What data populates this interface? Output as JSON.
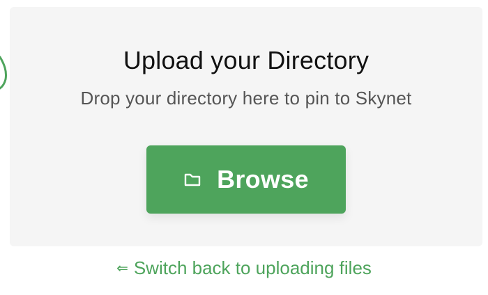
{
  "upload": {
    "title": "Upload your Directory",
    "subtitle": "Drop your directory here to pin to Skynet",
    "browse_button": {
      "label": "Browse",
      "icon": "folder-icon"
    },
    "switch_link": {
      "arrow": "⇐",
      "label": "Switch back to uploading files"
    }
  },
  "colors": {
    "accent": "#4ea45c",
    "dropzone_bg": "#f5f5f5",
    "title_text": "#111111",
    "subtitle_text": "#555555"
  }
}
